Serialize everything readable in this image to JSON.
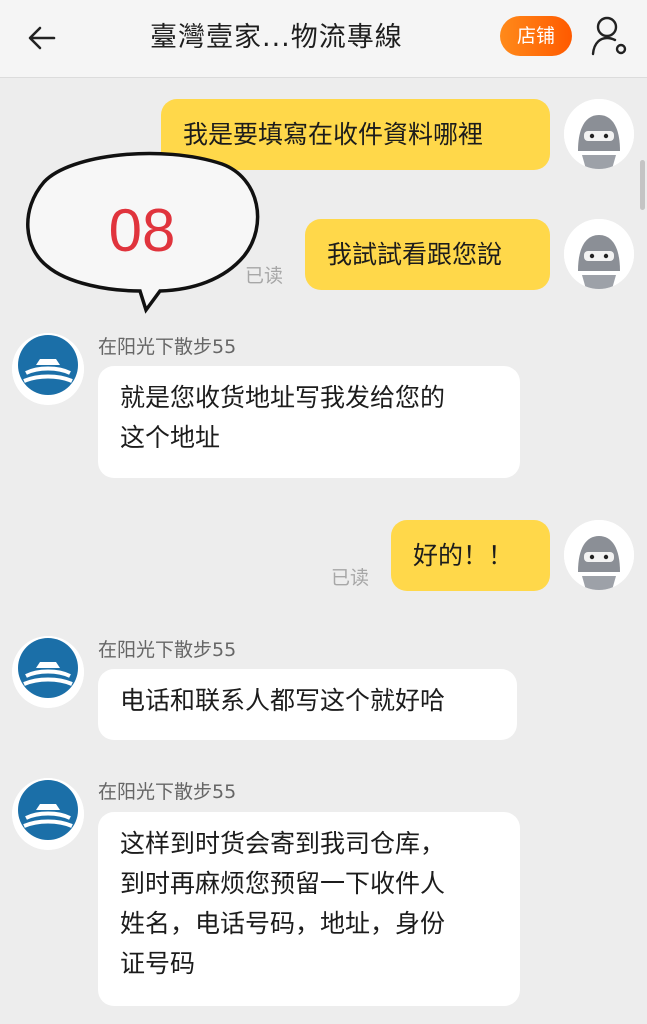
{
  "header": {
    "title": "臺灣壹家...物流專線",
    "shop_button": "店铺",
    "back_icon": "back-arrow-icon",
    "user_icon": "user-settings-icon"
  },
  "sticker": {
    "number": "08"
  },
  "messages": [
    {
      "side": "me",
      "text": "我是要填寫在收件資料哪裡"
    },
    {
      "side": "me",
      "text": "我試試看跟您說",
      "status": "已读"
    },
    {
      "side": "other",
      "sender": "在阳光下散步55",
      "lines": [
        "就是您收货地址写我发给您的",
        "这个地址"
      ]
    },
    {
      "side": "me",
      "text": "好的！！",
      "status": "已读"
    },
    {
      "side": "other",
      "sender": "在阳光下散步55",
      "lines": [
        "电话和联系人都写这个就好哈"
      ]
    },
    {
      "side": "other",
      "sender": "在阳光下散步55",
      "lines": [
        "这样到时货会寄到我司仓库，",
        "到时再麻烦您预留一下收件人",
        "姓名，电话号码，地址，身份",
        "证号码"
      ]
    }
  ],
  "colors": {
    "my_bubble": "#ffd84a",
    "shop_button": "#ff6a00",
    "sticker_number": "#e0343d",
    "background": "#ededed"
  }
}
